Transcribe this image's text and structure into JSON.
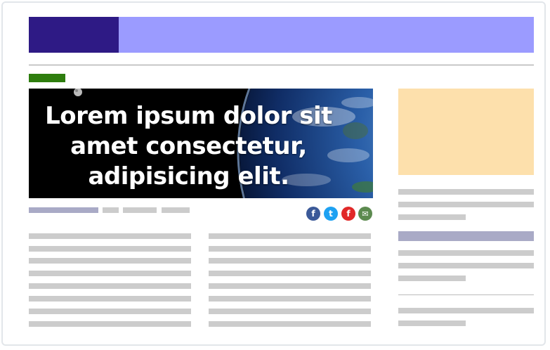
{
  "colors": {
    "header_dark": "#2e1a85",
    "header_light": "#9b9bff",
    "category_tag": "#2e7d0e",
    "ad_box": "#fde0ac",
    "meta_bar": "#a9aac6",
    "sidebar_heading": "#a9aac6",
    "placeholder_line": "#cccccc",
    "facebook": "#3b5998",
    "twitter": "#1da1f2",
    "flipboard": "#e12828",
    "email": "#5c8a4f"
  },
  "hero": {
    "title": "Lorem ipsum dolor sit amet consectetur, adipisicing elit."
  },
  "share": {
    "icons": [
      "facebook-icon",
      "twitter-icon",
      "flipboard-icon",
      "email-icon"
    ],
    "facebook_glyph": "f",
    "twitter_glyph": "t",
    "flipboard_glyph": "f",
    "email_glyph": "✉"
  }
}
